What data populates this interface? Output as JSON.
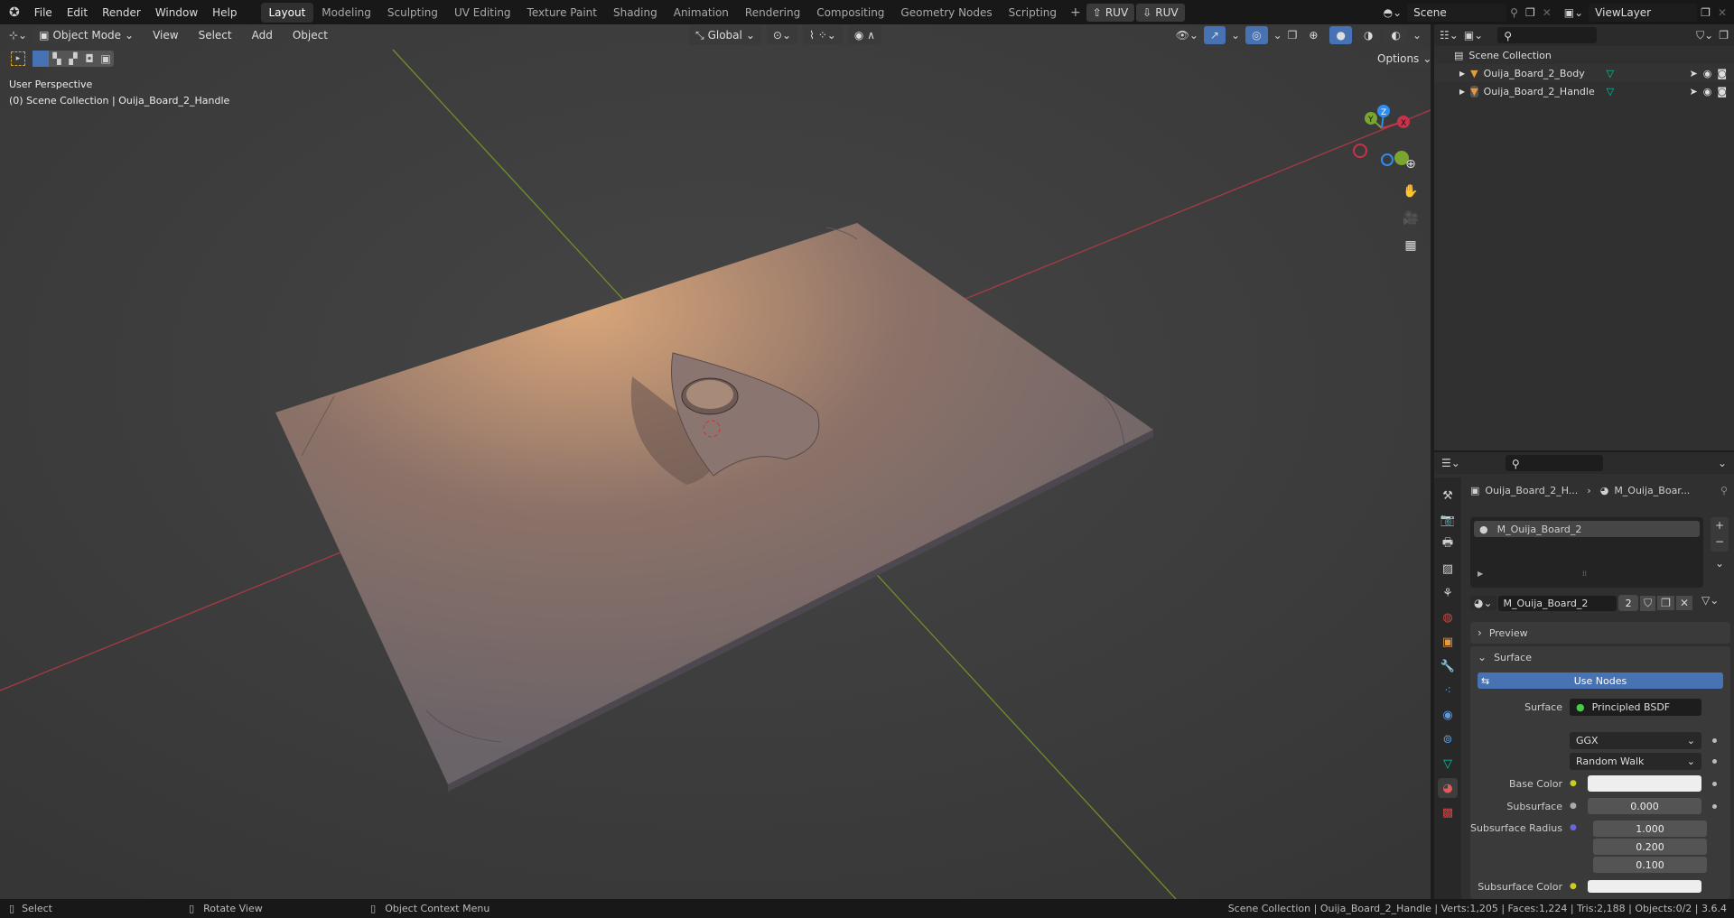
{
  "topbar": {
    "menus": [
      "File",
      "Edit",
      "Render",
      "Window",
      "Help"
    ],
    "workspaces": [
      "Layout",
      "Modeling",
      "Sculpting",
      "UV Editing",
      "Texture Paint",
      "Shading",
      "Animation",
      "Rendering",
      "Compositing",
      "Geometry Nodes",
      "Scripting"
    ],
    "ruv_up": "RUV",
    "ruv_down": "RUV",
    "scene": "Scene",
    "view_layer": "ViewLayer"
  },
  "viewport": {
    "mode": "Object Mode",
    "menus": [
      "View",
      "Select",
      "Add",
      "Object"
    ],
    "orientation": "Global",
    "options": "Options",
    "view_name": "User Perspective",
    "context": "(0) Scene Collection | Ouija_Board_2_Handle",
    "gizmo": {
      "x": "X",
      "y": "Y",
      "z": "Z"
    }
  },
  "outliner": {
    "root": "Scene Collection",
    "items": [
      {
        "name": "Ouija_Board_2_Body"
      },
      {
        "name": "Ouija_Board_2_Handle"
      }
    ]
  },
  "properties": {
    "breadcrumb_object": "Ouija_Board_2_H...",
    "breadcrumb_material": "M_Ouija_Boar...",
    "slot": "M_Ouija_Board_2",
    "material_name": "M_Ouija_Board_2",
    "users": "2",
    "panels": {
      "preview": "Preview",
      "surface": "Surface"
    },
    "use_nodes": "Use Nodes",
    "fields": {
      "surface_label": "Surface",
      "surface_value": "Principled BSDF",
      "distribution": "GGX",
      "subsurface_method": "Random Walk",
      "base_color_label": "Base Color",
      "subsurface_label": "Subsurface",
      "subsurface_value": "0.000",
      "radius_label": "Subsurface Radius",
      "radius": [
        "1.000",
        "0.200",
        "0.100"
      ],
      "subsurface_color_label": "Subsurface Color"
    }
  },
  "statusbar": {
    "select": "Select",
    "rotate": "Rotate View",
    "context_menu": "Object Context Menu",
    "stats": "Scene Collection | Ouija_Board_2_Handle | Verts:1,205 | Faces:1,224 | Tris:2,188 | Objects:0/2 | 3.6.4"
  },
  "colors": {
    "accent": "#4772b3",
    "x_axis": "#c8334a",
    "y_axis": "#7aa52e",
    "z_axis": "#2e8df0",
    "mesh": "#00c8a0"
  }
}
